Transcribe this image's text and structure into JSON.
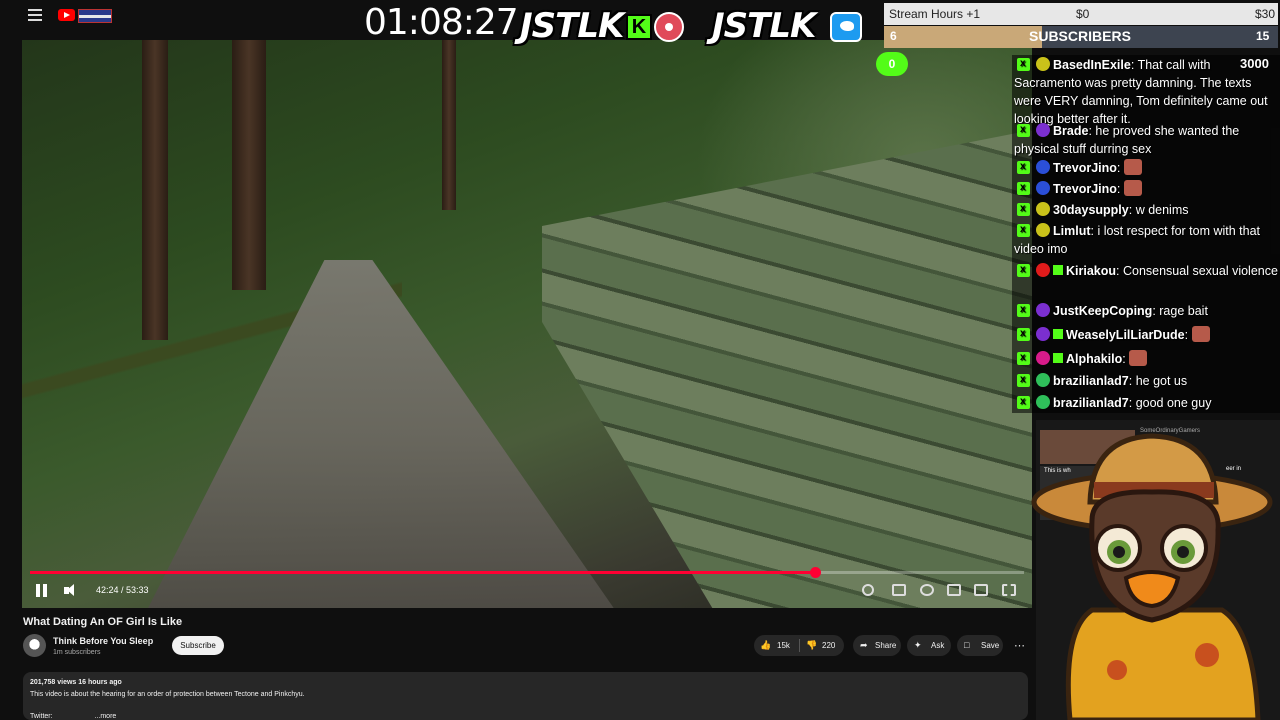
{
  "overlay": {
    "timer": "01:08:27",
    "brand_1": "JSTLK",
    "brand_2": "JSTLK",
    "kick_glyph": "K",
    "colors": {
      "kick_green": "#53fc18",
      "twitter_blue": "#1d9bf0",
      "progress_red": "#ff0033"
    }
  },
  "goals": {
    "stream_hours_label": "Stream Hours +1",
    "hours_min": "$0",
    "hours_max": "$30",
    "subscribers_label": "SUBSCRIBERS",
    "subs_current": "6",
    "subs_goal": "15",
    "subs_progress": 0.4,
    "counter_pill": "0",
    "counter_right": "3000"
  },
  "chat": {
    "messages": [
      {
        "user": "BasedInExile",
        "text": "That call with Sacramento was pretty damning. The texts were VERY damning, Tom definitely came out looking better after it.",
        "dot": "#c9c21a"
      },
      {
        "user": "Brade",
        "text": "he proved she wanted the physical stuff durring sex",
        "dot": "#7b2fd0"
      },
      {
        "user": "TrevorJino",
        "text": "",
        "dot": "#2b4fd8",
        "emote": true
      },
      {
        "user": "TrevorJino",
        "text": "",
        "dot": "#2b4fd8",
        "emote": true
      },
      {
        "user": "30daysupply",
        "text": "w denims",
        "dot": "#c9c21a"
      },
      {
        "user": "Limlut",
        "text": "i lost respect for tom with that video imo",
        "dot": "#c9c21a"
      },
      {
        "user": "Kiriakou",
        "text": "Consensual sexual violence",
        "dot": "#e01b1b",
        "badge": true
      },
      {
        "user": "JustKeepCoping",
        "text": "rage bait",
        "dot": "#7b2fd0"
      },
      {
        "user": "WeaselyLilLiarDude",
        "text": "",
        "dot": "#7b2fd0",
        "badge": true,
        "emote": true
      },
      {
        "user": "Alphakilo",
        "text": "",
        "dot": "#d81b8a",
        "badge": true,
        "emote": true
      },
      {
        "user": "brazilianlad7",
        "text": "he got us",
        "dot": "#2fbf5a"
      },
      {
        "user": "brazilianlad7",
        "text": "good one guy",
        "dot": "#2fbf5a"
      }
    ]
  },
  "player": {
    "current_time": "42:24",
    "duration": "53:33",
    "time_display": "42:24 / 53:33",
    "progress": 0.79
  },
  "video": {
    "title": "What Dating An OF Girl Is Like",
    "channel": "Think Before You Sleep",
    "subscribers": "1m subscribers",
    "subscribe_label": "Subscribe",
    "likes": "15k",
    "dislikes": "220",
    "share_label": "Share",
    "ask_label": "Ask",
    "save_label": "Save",
    "views_line": "201,758 views  16 hours ago",
    "description": "This video is about the hearing for an order of protection between Tectone and Pinkchyu.",
    "twitter_line": "Twitter:",
    "more_label": "...more"
  },
  "side": {
    "channel_text": "SomeOrdinaryGamers",
    "thumb_text": "This is wh",
    "thumb_text_right": "eer in"
  }
}
